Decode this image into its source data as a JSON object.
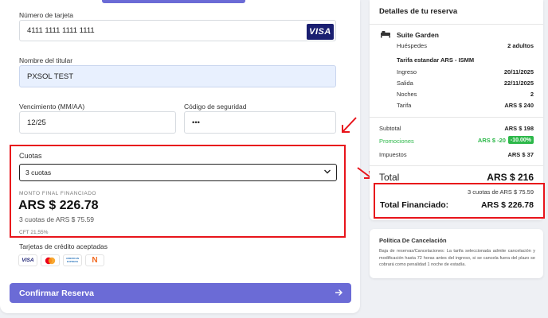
{
  "payment": {
    "card_number_label": "Número de tarjeta",
    "card_number_value": "4111 1111 1111 1111",
    "card_brand": "VISA",
    "holder_label": "Nombre del titular",
    "holder_value": "PXSOL TEST",
    "expiry_label": "Vencimiento (MM/AA)",
    "expiry_value": "12/25",
    "cvv_label": "Código de seguridad",
    "cvv_value": "•••"
  },
  "installments": {
    "label": "Cuotas",
    "selected": "3 cuotas",
    "final_label": "MONTO FINAL FINANCIADO",
    "final_amount": "ARS $ 226.78",
    "detail": "3 cuotas de ARS $ 75.59",
    "cft": "CFT 21,55%"
  },
  "accepted_cards": {
    "label": "Tarjetas de crédito aceptadas",
    "cards": [
      "visa-icon",
      "mastercard-icon",
      "amex-icon",
      "naranja-icon"
    ],
    "visa_text": "VISA",
    "amex_text": "AMERICAN EXPRESS",
    "naranja_text": "N"
  },
  "confirm_button": {
    "label": "Confirmar Reserva"
  },
  "summary": {
    "title": "Detalles de tu reserva",
    "room_name": "Suite Garden",
    "guests_label": "Huéspedes",
    "guests_value": "2 adultos",
    "rate_name": "Tarifa estandar ARS - ISMM",
    "checkin_label": "Ingreso",
    "checkin_value": "20/11/2025",
    "checkout_label": "Salida",
    "checkout_value": "22/11/2025",
    "nights_label": "Noches",
    "nights_value": "2",
    "rate_label": "Tarifa",
    "rate_value": "ARS $ 240",
    "subtotal_label": "Subtotal",
    "subtotal_value": "ARS $ 198",
    "promo_label": "Promociones",
    "promo_value": "ARS $ -20",
    "promo_badge": "-10.00%",
    "taxes_label": "Impuestos",
    "taxes_value": "ARS $ 37",
    "total_label": "Total",
    "total_value": "ARS $ 216",
    "financed_detail": "3 cuotas de ARS $ 75.59",
    "financed_label": "Total Financiado:",
    "financed_value": "ARS $ 226.78"
  },
  "policy": {
    "title": "Política De Cancelación",
    "text": "Baja de reservas/Cancelaciones: La tarifa seleccionada admite cancelación y modificación hasta 72 horas antes del ingreso, si se cancela fuera del plazo se cobrará como penalidad 1 noche de estadía."
  },
  "colors": {
    "accent": "#6b6bd6",
    "highlight_red": "#e8141b",
    "promo_green": "#2db84a"
  }
}
